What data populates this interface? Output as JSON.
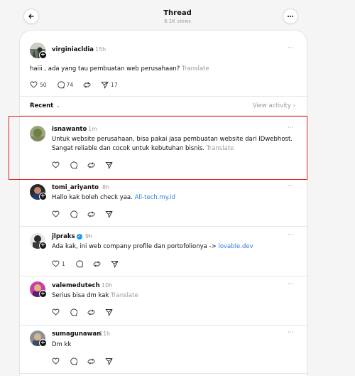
{
  "header": {
    "title": "Thread",
    "views": "6.1K views",
    "more_label": "···"
  },
  "original_post": {
    "username": "virginiacldia",
    "time": "15h",
    "text": "haiii , ada yang tau pembuatan web perusahaan?",
    "translate": "Translate",
    "likes": "50",
    "replies": "74",
    "shares": "17"
  },
  "sort": {
    "label": "Recent",
    "chevron": "⌄",
    "view_activity": "View activity ›"
  },
  "replies": [
    {
      "username": "isnawanto",
      "time": "1m",
      "text": "Untuk website perusahaan, bisa pakai jasa pembuatan website dari IDwebhost. Sangat reliable dan cocok untuk kebutuhan bisnis.",
      "translate": "Translate",
      "like_count": ""
    },
    {
      "username": "tomi_ariyanto",
      "time": "8h",
      "text": "Hallo kak boleh check yaa.",
      "link": "All-tech.my.id",
      "like_count": ""
    },
    {
      "username": "jlpraks",
      "time": "9h",
      "text": "Ada kak, ini web company profile dan portofolionya ->",
      "link": "lovable.dev",
      "like_count": "1"
    },
    {
      "username": "valemedutech",
      "time": "10h",
      "text": "Serius bisa dm kak",
      "translate": "Translate",
      "like_count": ""
    },
    {
      "username": "sumagunawan",
      "time": "11h",
      "text": "Dm kk",
      "like_count": ""
    }
  ],
  "colors": {
    "link": "#2f7fd7",
    "highlight_border": "#e02020",
    "muted": "#999999"
  },
  "icons": [
    "back-arrow-icon",
    "more-icon",
    "heart-icon",
    "comment-icon",
    "repost-icon",
    "share-icon",
    "follow-plus-icon",
    "verified-icon"
  ]
}
